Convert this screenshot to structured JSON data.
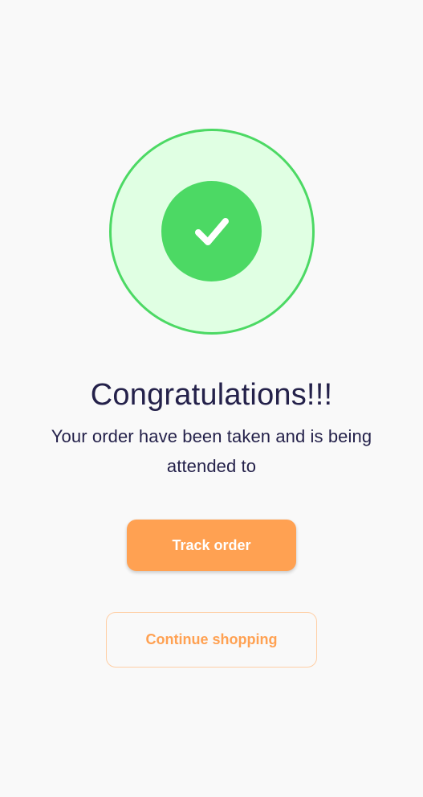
{
  "success": {
    "icon": "checkmark-icon",
    "title": "Congratulations!!!",
    "message": "Your order have been taken and is being attended to"
  },
  "actions": {
    "track_label": "Track order",
    "continue_label": "Continue shopping"
  },
  "colors": {
    "background": "#F9F9F9",
    "success_green": "#4CD964",
    "success_light": "#E0FFE3",
    "accent_orange": "#FFA152",
    "text_dark": "#24214A"
  }
}
